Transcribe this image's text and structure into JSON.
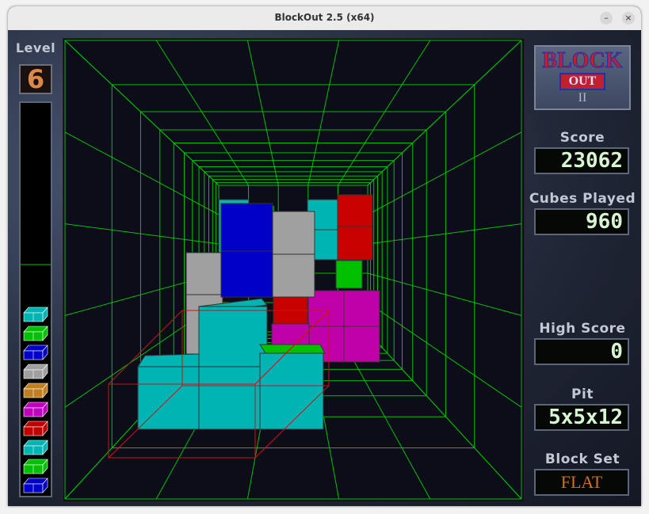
{
  "window": {
    "title": "BlockOut 2.5 (x64)"
  },
  "controls": {
    "minimize": "–",
    "close": "×"
  },
  "level": {
    "label": "Level",
    "value": "6"
  },
  "logo": {
    "line1": "BLOCK",
    "line2": "OUT",
    "line3": "II"
  },
  "score": {
    "label": "Score",
    "value": "23062"
  },
  "cubes_played": {
    "label": "Cubes Played",
    "value": "960"
  },
  "high_score": {
    "label": "High Score",
    "value": "0"
  },
  "pit": {
    "label": "Pit",
    "value": "5x5x12"
  },
  "block_set": {
    "label": "Block Set",
    "value": "FLAT"
  },
  "layer_colors": [
    "#00b4b4",
    "#00c000",
    "#0000c8",
    "#a0a0a0",
    "#c08020",
    "#c000c0",
    "#c00000",
    "#00b4b4",
    "#00c000",
    "#0000c8"
  ],
  "colors": {
    "grid": "#00c000",
    "pit_bg": "#0d0d1a",
    "lcd_text": "#d6f5d0",
    "label": "#c2c8d4"
  }
}
